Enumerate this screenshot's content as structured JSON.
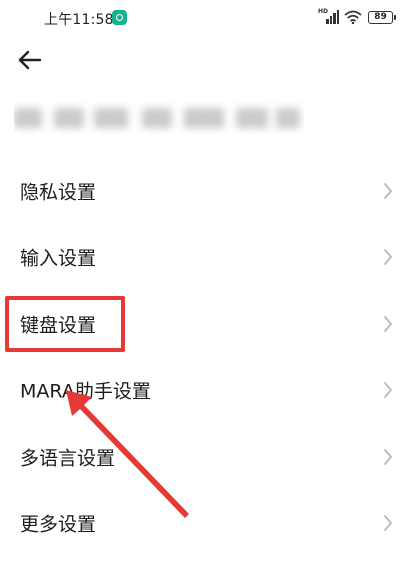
{
  "status_bar": {
    "time": "上午11:58",
    "network_label": "HD",
    "battery": "89"
  },
  "header": {
    "back_icon": "arrow-left-icon"
  },
  "menu": {
    "items": [
      {
        "label": "隐私设置"
      },
      {
        "label": "输入设置"
      },
      {
        "label": "键盘设置"
      },
      {
        "label": "MARA助手设置"
      },
      {
        "label": "多语言设置"
      },
      {
        "label": "更多设置"
      }
    ],
    "chevron_icon": "chevron-right-icon"
  },
  "annotations": {
    "highlight_color": "#e53935",
    "highlighted_item": "键盘设置"
  }
}
